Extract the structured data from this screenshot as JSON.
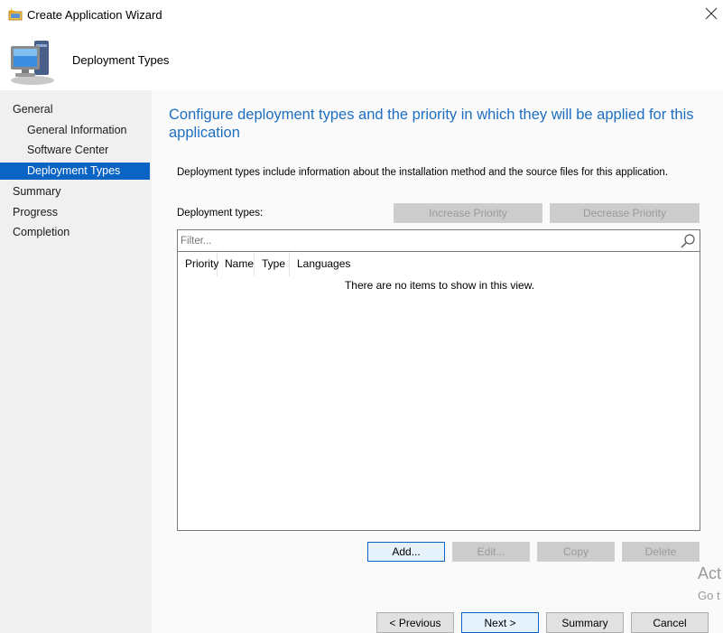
{
  "window": {
    "title": "Create Application Wizard"
  },
  "header": {
    "title": "Deployment Types"
  },
  "sidebar": {
    "items": [
      {
        "label": "General",
        "level": 1,
        "active": false
      },
      {
        "label": "General Information",
        "level": 2,
        "active": false
      },
      {
        "label": "Software Center",
        "level": 2,
        "active": false
      },
      {
        "label": "Deployment Types",
        "level": 2,
        "active": true
      },
      {
        "label": "Summary",
        "level": 1,
        "active": false
      },
      {
        "label": "Progress",
        "level": 1,
        "active": false
      },
      {
        "label": "Completion",
        "level": 1,
        "active": false
      }
    ]
  },
  "main": {
    "heading": "Configure deployment types and the priority in which they will be applied for this application",
    "description": "Deployment types include information about the installation method and the source files for this application.",
    "deployment_types_label": "Deployment types:",
    "increase_priority": "Increase Priority",
    "decrease_priority": "Decrease Priority",
    "filter_placeholder": "Filter...",
    "columns": [
      "Priority",
      "Name",
      "Type",
      "Languages"
    ],
    "empty_message": "There are no items to show in this view.",
    "actions": {
      "add": "Add...",
      "edit": "Edit...",
      "copy": "Copy",
      "delete": "Delete"
    }
  },
  "footer": {
    "previous": "< Previous",
    "next": "Next >",
    "summary": "Summary",
    "cancel": "Cancel"
  },
  "watermark": {
    "line1": "Act",
    "line2": "Go t"
  },
  "colors": {
    "accent": "#0a64c4",
    "heading": "#1f6fc0",
    "sidebar_bg": "#f0f0f0"
  }
}
